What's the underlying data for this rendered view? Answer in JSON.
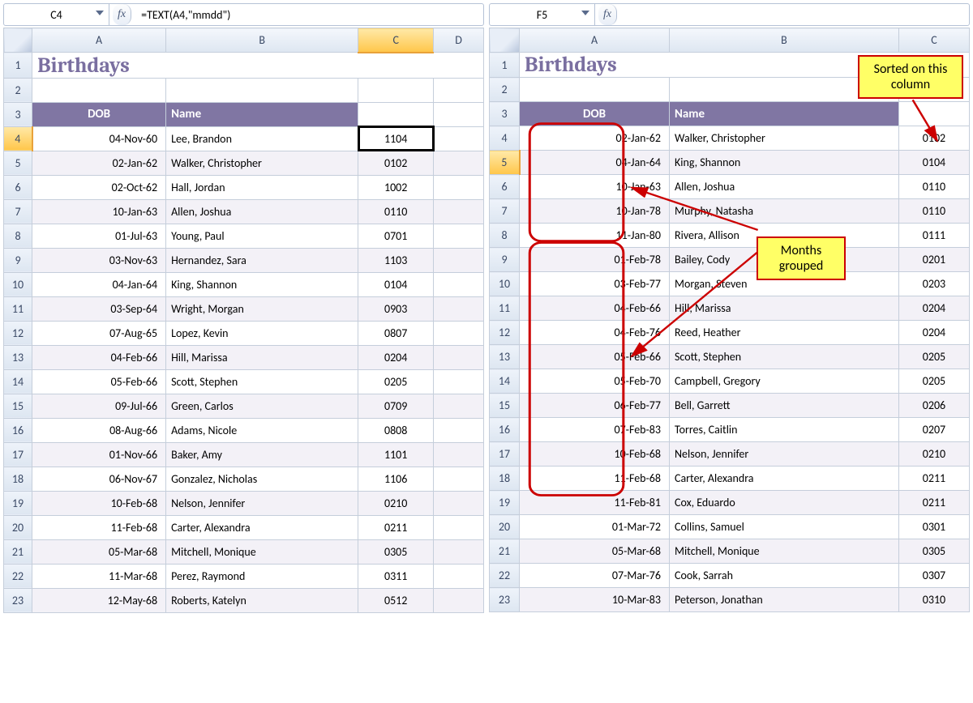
{
  "left": {
    "nameBox": "C4",
    "formula": "=TEXT(A4,\"mmdd\")",
    "colHeaders": [
      "A",
      "B",
      "C",
      "D"
    ],
    "title": "Birthdays",
    "tableHeaders": {
      "dob": "DOB",
      "name": "Name"
    },
    "selectedCol": "C",
    "selectedRow": 4,
    "rows": [
      {
        "n": 4,
        "dob": "04-Nov-60",
        "name": "Lee, Brandon",
        "code": "1104"
      },
      {
        "n": 5,
        "dob": "02-Jan-62",
        "name": "Walker, Christopher",
        "code": "0102"
      },
      {
        "n": 6,
        "dob": "02-Oct-62",
        "name": "Hall, Jordan",
        "code": "1002"
      },
      {
        "n": 7,
        "dob": "10-Jan-63",
        "name": "Allen, Joshua",
        "code": "0110"
      },
      {
        "n": 8,
        "dob": "01-Jul-63",
        "name": "Young, Paul",
        "code": "0701"
      },
      {
        "n": 9,
        "dob": "03-Nov-63",
        "name": "Hernandez, Sara",
        "code": "1103"
      },
      {
        "n": 10,
        "dob": "04-Jan-64",
        "name": "King, Shannon",
        "code": "0104"
      },
      {
        "n": 11,
        "dob": "03-Sep-64",
        "name": "Wright, Morgan",
        "code": "0903"
      },
      {
        "n": 12,
        "dob": "07-Aug-65",
        "name": "Lopez, Kevin",
        "code": "0807"
      },
      {
        "n": 13,
        "dob": "04-Feb-66",
        "name": "Hill, Marissa",
        "code": "0204"
      },
      {
        "n": 14,
        "dob": "05-Feb-66",
        "name": "Scott, Stephen",
        "code": "0205"
      },
      {
        "n": 15,
        "dob": "09-Jul-66",
        "name": "Green, Carlos",
        "code": "0709"
      },
      {
        "n": 16,
        "dob": "08-Aug-66",
        "name": "Adams, Nicole",
        "code": "0808"
      },
      {
        "n": 17,
        "dob": "01-Nov-66",
        "name": "Baker, Amy",
        "code": "1101"
      },
      {
        "n": 18,
        "dob": "06-Nov-67",
        "name": "Gonzalez, Nicholas",
        "code": "1106"
      },
      {
        "n": 19,
        "dob": "10-Feb-68",
        "name": "Nelson, Jennifer",
        "code": "0210"
      },
      {
        "n": 20,
        "dob": "11-Feb-68",
        "name": "Carter, Alexandra",
        "code": "0211"
      },
      {
        "n": 21,
        "dob": "05-Mar-68",
        "name": "Mitchell, Monique",
        "code": "0305"
      },
      {
        "n": 22,
        "dob": "11-Mar-68",
        "name": "Perez, Raymond",
        "code": "0311"
      },
      {
        "n": 23,
        "dob": "12-May-68",
        "name": "Roberts, Katelyn",
        "code": "0512"
      }
    ]
  },
  "right": {
    "nameBox": "F5",
    "formula": "",
    "colHeaders": [
      "A",
      "B",
      "C"
    ],
    "title": "Birthdays",
    "tableHeaders": {
      "dob": "DOB",
      "name": "Name"
    },
    "selectedRow": 5,
    "callouts": {
      "sorted": "Sorted on this column",
      "grouped": "Months grouped"
    },
    "rows": [
      {
        "n": 4,
        "dob": "02-Jan-62",
        "name": "Walker, Christopher",
        "code": "0102"
      },
      {
        "n": 5,
        "dob": "04-Jan-64",
        "name": "King, Shannon",
        "code": "0104"
      },
      {
        "n": 6,
        "dob": "10-Jan-63",
        "name": "Allen, Joshua",
        "code": "0110"
      },
      {
        "n": 7,
        "dob": "10-Jan-78",
        "name": "Murphy, Natasha",
        "code": "0110"
      },
      {
        "n": 8,
        "dob": "11-Jan-80",
        "name": "Rivera, Allison",
        "code": "0111"
      },
      {
        "n": 9,
        "dob": "01-Feb-78",
        "name": "Bailey, Cody",
        "code": "0201"
      },
      {
        "n": 10,
        "dob": "03-Feb-77",
        "name": "Morgan, Steven",
        "code": "0203"
      },
      {
        "n": 11,
        "dob": "04-Feb-66",
        "name": "Hill, Marissa",
        "code": "0204"
      },
      {
        "n": 12,
        "dob": "04-Feb-76",
        "name": "Reed, Heather",
        "code": "0204"
      },
      {
        "n": 13,
        "dob": "05-Feb-66",
        "name": "Scott, Stephen",
        "code": "0205"
      },
      {
        "n": 14,
        "dob": "05-Feb-70",
        "name": "Campbell, Gregory",
        "code": "0205"
      },
      {
        "n": 15,
        "dob": "06-Feb-77",
        "name": "Bell, Garrett",
        "code": "0206"
      },
      {
        "n": 16,
        "dob": "07-Feb-83",
        "name": "Torres, Caitlin",
        "code": "0207"
      },
      {
        "n": 17,
        "dob": "10-Feb-68",
        "name": "Nelson, Jennifer",
        "code": "0210"
      },
      {
        "n": 18,
        "dob": "11-Feb-68",
        "name": "Carter, Alexandra",
        "code": "0211"
      },
      {
        "n": 19,
        "dob": "11-Feb-81",
        "name": "Cox, Eduardo",
        "code": "0211"
      },
      {
        "n": 20,
        "dob": "01-Mar-72",
        "name": "Collins, Samuel",
        "code": "0301"
      },
      {
        "n": 21,
        "dob": "05-Mar-68",
        "name": "Mitchell, Monique",
        "code": "0305"
      },
      {
        "n": 22,
        "dob": "07-Mar-76",
        "name": "Cook, Sarrah",
        "code": "0307"
      },
      {
        "n": 23,
        "dob": "10-Mar-83",
        "name": "Peterson, Jonathan",
        "code": "0310"
      }
    ]
  },
  "fxLabel": "fx"
}
